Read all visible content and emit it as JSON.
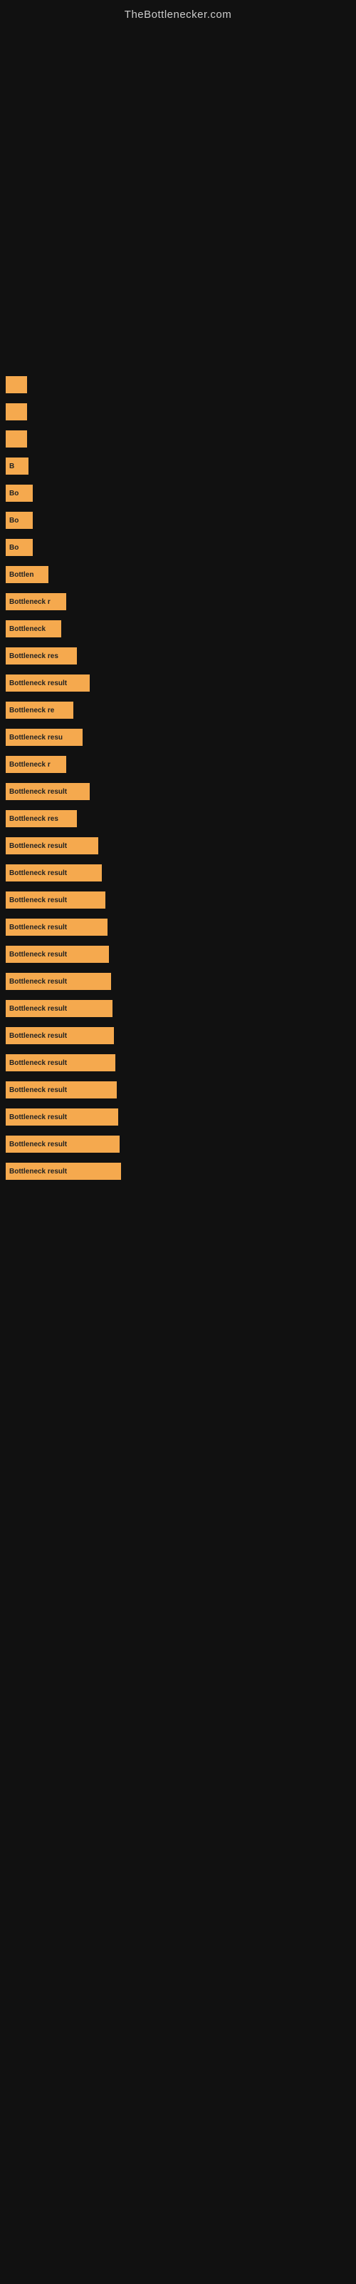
{
  "site": {
    "title": "TheBottlenecker.com"
  },
  "bars": [
    {
      "label": "",
      "width": 30,
      "text": ""
    },
    {
      "label": "",
      "width": 30,
      "text": ""
    },
    {
      "label": "",
      "width": 30,
      "text": ""
    },
    {
      "label": "B",
      "width": 32,
      "text": "B"
    },
    {
      "label": "Bo",
      "width": 38,
      "text": "Bo"
    },
    {
      "label": "Bo",
      "width": 38,
      "text": "Bo"
    },
    {
      "label": "Bo",
      "width": 38,
      "text": "Bo"
    },
    {
      "label": "Bottlen",
      "width": 60,
      "text": "Bottlen"
    },
    {
      "label": "Bottleneck r",
      "width": 85,
      "text": "Bottleneck r"
    },
    {
      "label": "Bottleneck",
      "width": 78,
      "text": "Bottleneck"
    },
    {
      "label": "Bottleneck res",
      "width": 100,
      "text": "Bottleneck res"
    },
    {
      "label": "Bottleneck result",
      "width": 118,
      "text": "Bottleneck result"
    },
    {
      "label": "Bottleneck re",
      "width": 95,
      "text": "Bottleneck re"
    },
    {
      "label": "Bottleneck resu",
      "width": 108,
      "text": "Bottleneck resu"
    },
    {
      "label": "Bottleneck r",
      "width": 85,
      "text": "Bottleneck r"
    },
    {
      "label": "Bottleneck result",
      "width": 118,
      "text": "Bottleneck result"
    },
    {
      "label": "Bottleneck res",
      "width": 100,
      "text": "Bottleneck res"
    },
    {
      "label": "Bottleneck result",
      "width": 130,
      "text": "Bottleneck result"
    },
    {
      "label": "Bottleneck result",
      "width": 135,
      "text": "Bottleneck result"
    },
    {
      "label": "Bottleneck result",
      "width": 140,
      "text": "Bottleneck result"
    },
    {
      "label": "Bottleneck result",
      "width": 143,
      "text": "Bottleneck result"
    },
    {
      "label": "Bottleneck result",
      "width": 145,
      "text": "Bottleneck result"
    },
    {
      "label": "Bottleneck result",
      "width": 148,
      "text": "Bottleneck result"
    },
    {
      "label": "Bottleneck result",
      "width": 150,
      "text": "Bottleneck result"
    },
    {
      "label": "Bottleneck result",
      "width": 152,
      "text": "Bottleneck result"
    },
    {
      "label": "Bottleneck result",
      "width": 154,
      "text": "Bottleneck result"
    },
    {
      "label": "Bottleneck result",
      "width": 156,
      "text": "Bottleneck result"
    },
    {
      "label": "Bottleneck result",
      "width": 158,
      "text": "Bottleneck result"
    },
    {
      "label": "Bottleneck result",
      "width": 160,
      "text": "Bottleneck result"
    },
    {
      "label": "Bottleneck result",
      "width": 162,
      "text": "Bottleneck result"
    }
  ]
}
